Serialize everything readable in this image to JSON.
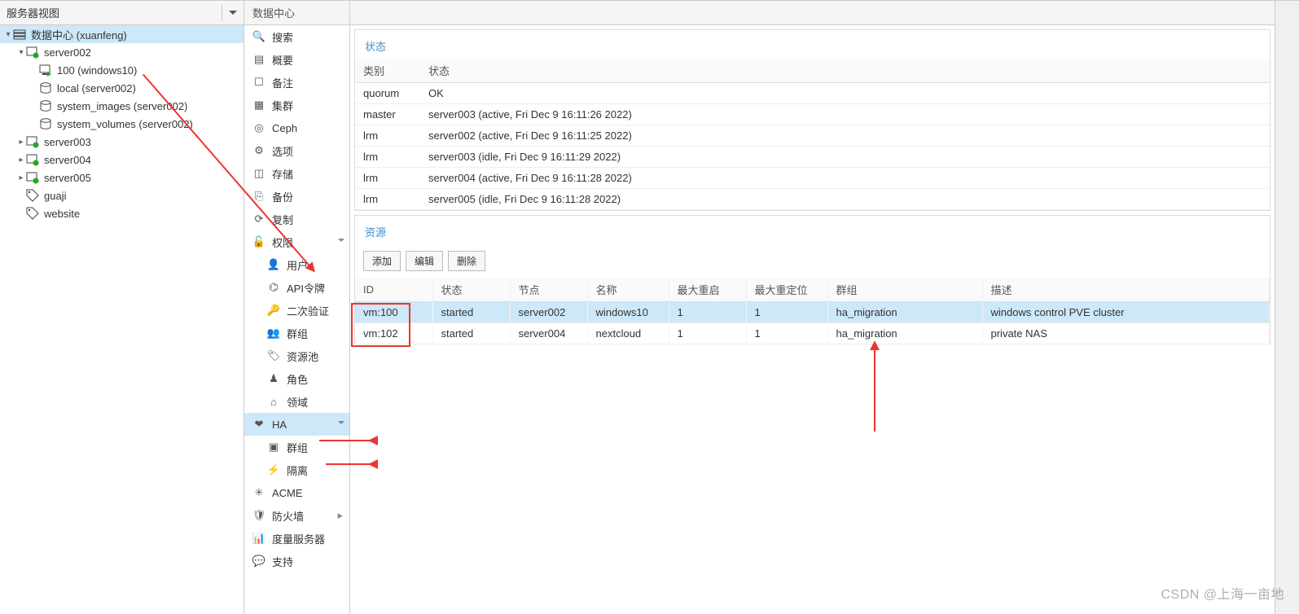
{
  "view_selector": {
    "label": "服务器视图"
  },
  "tree": {
    "datacenter": {
      "label": "数据中心 (xuanfeng)"
    },
    "server002": {
      "label": "server002"
    },
    "vm100": {
      "label": "100 (windows10)"
    },
    "local": {
      "label": "local (server002)"
    },
    "system_images": {
      "label": "system_images (server002)"
    },
    "system_volumes": {
      "label": "system_volumes (server002)"
    },
    "server003": {
      "label": "server003"
    },
    "server004": {
      "label": "server004"
    },
    "server005": {
      "label": "server005"
    },
    "guaji": {
      "label": "guaji"
    },
    "website": {
      "label": "website"
    }
  },
  "breadcrumb": "数据中心",
  "menu": {
    "search": "搜索",
    "summary": "概要",
    "notes": "备注",
    "cluster": "集群",
    "ceph": "Ceph",
    "options": "选项",
    "storage": "存储",
    "backup": "备份",
    "replication": "复制",
    "permissions": "权限",
    "users": "用户",
    "api_tokens": "API令牌",
    "twofa": "二次验证",
    "groups": "群组",
    "pools": "资源池",
    "roles": "角色",
    "realms": "领域",
    "ha": "HA",
    "ha_groups": "群组",
    "fencing": "隔离",
    "acme": "ACME",
    "firewall": "防火墙",
    "metrics": "度量服务器",
    "support": "支持"
  },
  "status": {
    "title": "状态",
    "col_type": "类别",
    "col_status": "状态",
    "rows": [
      {
        "type": "quorum",
        "status": "OK"
      },
      {
        "type": "master",
        "status": "server003 (active, Fri Dec 9 16:11:26 2022)"
      },
      {
        "type": "lrm",
        "status": "server002 (active, Fri Dec 9 16:11:25 2022)"
      },
      {
        "type": "lrm",
        "status": "server003 (idle, Fri Dec 9 16:11:29 2022)"
      },
      {
        "type": "lrm",
        "status": "server004 (active, Fri Dec 9 16:11:28 2022)"
      },
      {
        "type": "lrm",
        "status": "server005 (idle, Fri Dec 9 16:11:28 2022)"
      }
    ]
  },
  "resources": {
    "title": "资源",
    "buttons": {
      "add": "添加",
      "edit": "编辑",
      "remove": "删除"
    },
    "cols": {
      "id": "ID",
      "state": "状态",
      "node": "节点",
      "name": "名称",
      "max_restart": "最大重启",
      "max_relocate": "最大重定位",
      "group": "群组",
      "desc": "描述"
    },
    "rows": [
      {
        "id": "vm:100",
        "state": "started",
        "node": "server002",
        "name": "windows10",
        "max_restart": "1",
        "max_relocate": "1",
        "group": "ha_migration",
        "desc": "windows control PVE cluster"
      },
      {
        "id": "vm:102",
        "state": "started",
        "node": "server004",
        "name": "nextcloud",
        "max_restart": "1",
        "max_relocate": "1",
        "group": "ha_migration",
        "desc": "private NAS"
      }
    ]
  },
  "watermark": "CSDN @上海一亩地"
}
